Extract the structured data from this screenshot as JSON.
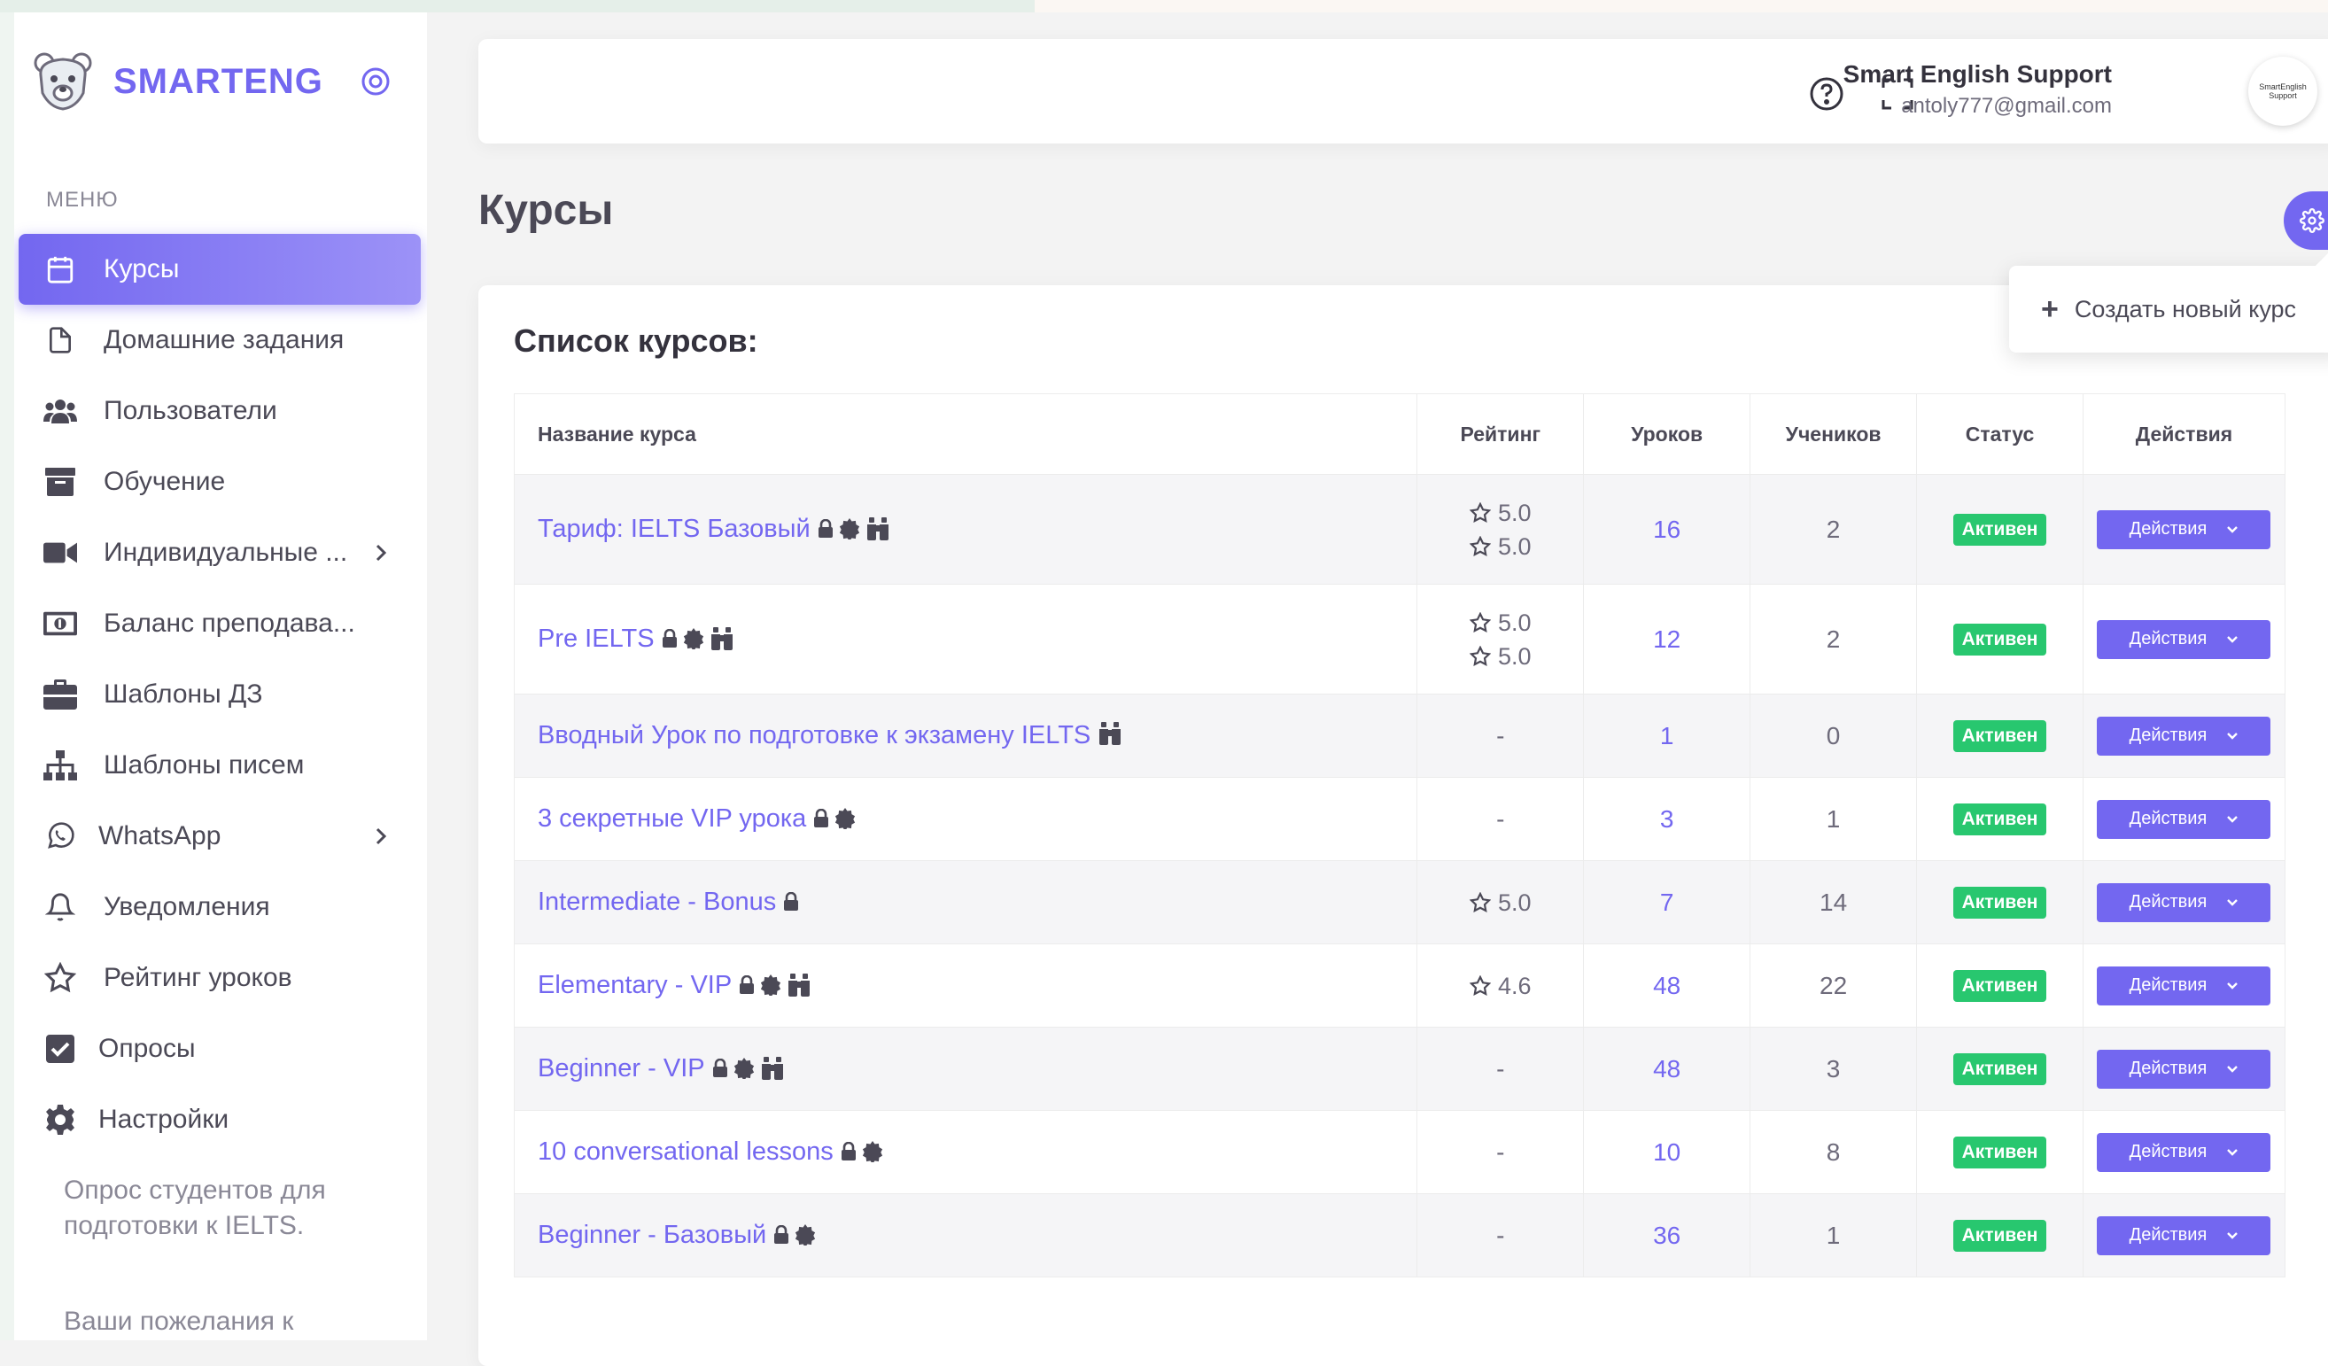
{
  "sidebar": {
    "brand": "SMARTENG",
    "menu_header": "МЕНЮ",
    "items": [
      {
        "label": "Курсы",
        "icon": "calendar-icon"
      },
      {
        "label": "Домашние задания",
        "icon": "file-icon"
      },
      {
        "label": "Пользователи",
        "icon": "users-icon"
      },
      {
        "label": "Обучение",
        "icon": "archive-icon"
      },
      {
        "label": "Индивидуальные ...",
        "icon": "video-icon"
      },
      {
        "label": "Баланс преподава...",
        "icon": "money-bill-icon"
      },
      {
        "label": "Шаблоны ДЗ",
        "icon": "briefcase-icon"
      },
      {
        "label": "Шаблоны писем",
        "icon": "sitemap-icon"
      },
      {
        "label": "WhatsApp",
        "icon": "whatsapp-icon"
      },
      {
        "label": "Уведомления",
        "icon": "bell-icon"
      },
      {
        "label": "Рейтинг уроков",
        "icon": "star-icon"
      },
      {
        "label": "Опросы",
        "icon": "check-square-icon"
      },
      {
        "label": "Настройки",
        "icon": "cog-icon"
      }
    ],
    "extra_links": [
      "Опрос студентов для подготовки к IELTS.",
      "Ваши пожелания к"
    ]
  },
  "header": {
    "user_name": "Smart English Support",
    "user_email": "antoly777@gmail.com",
    "avatar_text": "SmartEnglish Support"
  },
  "page": {
    "title": "Курсы",
    "create_label": "Создать новый курс"
  },
  "table": {
    "title": "Список курсов:",
    "columns": [
      "Название курса",
      "Рейтинг",
      "Уроков",
      "Учеников",
      "Статус",
      "Действия"
    ],
    "rows": [
      {
        "name": "Тариф: IELTS Базовый",
        "glyphs": [
          "lock-icon",
          "badge-icon",
          "binoculars-icon"
        ],
        "ratings": [
          "5.0",
          "5.0"
        ],
        "lessons": "16",
        "students": "2",
        "status": "Активен",
        "action": "Действия"
      },
      {
        "name": "Pre IELTS",
        "glyphs": [
          "lock-icon",
          "badge-icon",
          "binoculars-icon"
        ],
        "ratings": [
          "5.0",
          "5.0"
        ],
        "lessons": "12",
        "students": "2",
        "status": "Активен",
        "action": "Действия"
      },
      {
        "name": "Вводный Урок по подготовке к экзамену IELTS",
        "glyphs": [
          "binoculars-icon"
        ],
        "ratings": [],
        "rating_text": "-",
        "lessons": "1",
        "students": "0",
        "status": "Активен",
        "action": "Действия"
      },
      {
        "name": "3 секретные VIP урока",
        "glyphs": [
          "lock-icon",
          "badge-icon"
        ],
        "ratings": [],
        "rating_text": "-",
        "lessons": "3",
        "students": "1",
        "status": "Активен",
        "action": "Действия"
      },
      {
        "name": "Intermediate - Bonus",
        "glyphs": [
          "lock-icon"
        ],
        "ratings": [
          "5.0"
        ],
        "lessons": "7",
        "students": "14",
        "status": "Активен",
        "action": "Действия"
      },
      {
        "name": "Elementary - VIP",
        "glyphs": [
          "lock-icon",
          "badge-icon",
          "binoculars-icon"
        ],
        "ratings": [
          "4.6"
        ],
        "lessons": "48",
        "students": "22",
        "status": "Активен",
        "action": "Действия"
      },
      {
        "name": "Beginner - VIP",
        "glyphs": [
          "lock-icon",
          "badge-icon",
          "binoculars-icon"
        ],
        "ratings": [],
        "rating_text": "-",
        "lessons": "48",
        "students": "3",
        "status": "Активен",
        "action": "Действия"
      },
      {
        "name": "10 conversational lessons",
        "glyphs": [
          "lock-icon",
          "badge-icon"
        ],
        "ratings": [],
        "rating_text": "-",
        "lessons": "10",
        "students": "8",
        "status": "Активен",
        "action": "Действия"
      },
      {
        "name": "Beginner - Базовый",
        "glyphs": [
          "lock-icon",
          "badge-icon"
        ],
        "ratings": [],
        "rating_text": "-",
        "lessons": "36",
        "students": "1",
        "status": "Активен",
        "action": "Действия"
      }
    ]
  }
}
